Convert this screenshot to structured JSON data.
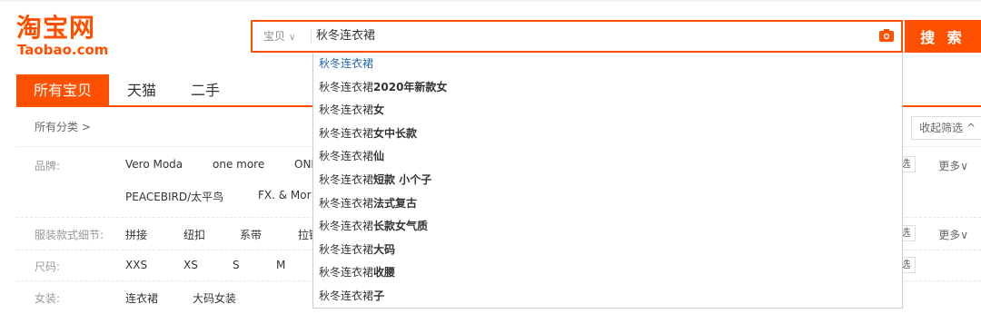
{
  "logo": {
    "cn": "淘宝网",
    "en": "Taobao.com"
  },
  "search": {
    "scope_label": "宝贝",
    "query": "秋冬连衣裙",
    "button_label": "搜 索"
  },
  "tabs": [
    "所有宝贝",
    "天猫",
    "二手"
  ],
  "breadcrumb": "所有分类 >",
  "collapse_label": "收起筛选 ^",
  "filters": {
    "brand": {
      "label": "品牌:",
      "row1": [
        "Vero Moda",
        "one more",
        "ONL"
      ],
      "row2": [
        "PEACEBIRD/太平鸟",
        "FX. & Mor"
      ],
      "multi": "选",
      "more": "更多∨"
    },
    "detail": {
      "label": "服装款式细节:",
      "values": [
        "拼接",
        "纽扣",
        "系带",
        "拉链"
      ],
      "multi": "选",
      "more": "更多∨"
    },
    "size": {
      "label": "尺码:",
      "values": [
        "XXS",
        "XS",
        "S",
        "M"
      ],
      "multi": "选"
    },
    "women": {
      "label": "女装:",
      "values": [
        "连衣裙",
        "大码女装"
      ]
    }
  },
  "suggestions": [
    {
      "prefix": "秋冬连衣裙",
      "suffix": ""
    },
    {
      "prefix": "秋冬连衣裙",
      "suffix": "2020年新款女"
    },
    {
      "prefix": "秋冬连衣裙",
      "suffix": "女"
    },
    {
      "prefix": "秋冬连衣裙",
      "suffix": "女中长款"
    },
    {
      "prefix": "秋冬连衣裙",
      "suffix": "仙"
    },
    {
      "prefix": "秋冬连衣裙",
      "suffix": "短款 小个子"
    },
    {
      "prefix": "秋冬连衣裙",
      "suffix": "法式复古"
    },
    {
      "prefix": "秋冬连衣裙",
      "suffix": "长款女气质"
    },
    {
      "prefix": "秋冬连衣裙",
      "suffix": "大码"
    },
    {
      "prefix": "秋冬连衣裙",
      "suffix": "收腰"
    },
    {
      "prefix": "秋冬连衣裙",
      "suffix": "子"
    }
  ],
  "colors": {
    "accent": "#ff5000"
  }
}
